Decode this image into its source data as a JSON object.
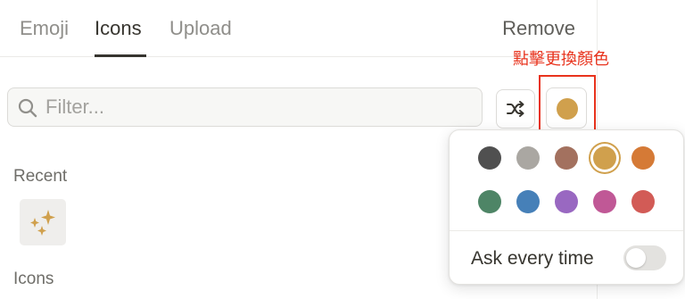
{
  "tabs": [
    {
      "label": "Emoji",
      "active": false
    },
    {
      "label": "Icons",
      "active": true
    },
    {
      "label": "Upload",
      "active": false
    }
  ],
  "remove_label": "Remove",
  "annotation": "點擊更換顏色",
  "filter": {
    "placeholder": "Filter...",
    "value": "",
    "icon": "search-icon"
  },
  "shuffle_icon": "shuffle-icon",
  "current_color": "#d0a04d",
  "sections": {
    "recent": "Recent",
    "icons": "Icons"
  },
  "recent_icons": [
    {
      "name": "sparkles-icon",
      "color": "#d0a04d"
    }
  ],
  "color_picker": {
    "colors": [
      {
        "name": "gray",
        "hex": "#505050"
      },
      {
        "name": "light-gray",
        "hex": "#aaa7a2"
      },
      {
        "name": "brown",
        "hex": "#a3715f"
      },
      {
        "name": "yellow",
        "hex": "#d0a04d",
        "selected": true
      },
      {
        "name": "orange",
        "hex": "#d57a36"
      },
      {
        "name": "green",
        "hex": "#4e8566"
      },
      {
        "name": "blue",
        "hex": "#4680b8"
      },
      {
        "name": "purple",
        "hex": "#9968c1"
      },
      {
        "name": "pink",
        "hex": "#c05896"
      },
      {
        "name": "red",
        "hex": "#d25b56"
      }
    ],
    "ask_every_time_label": "Ask every time",
    "ask_every_time": false
  }
}
